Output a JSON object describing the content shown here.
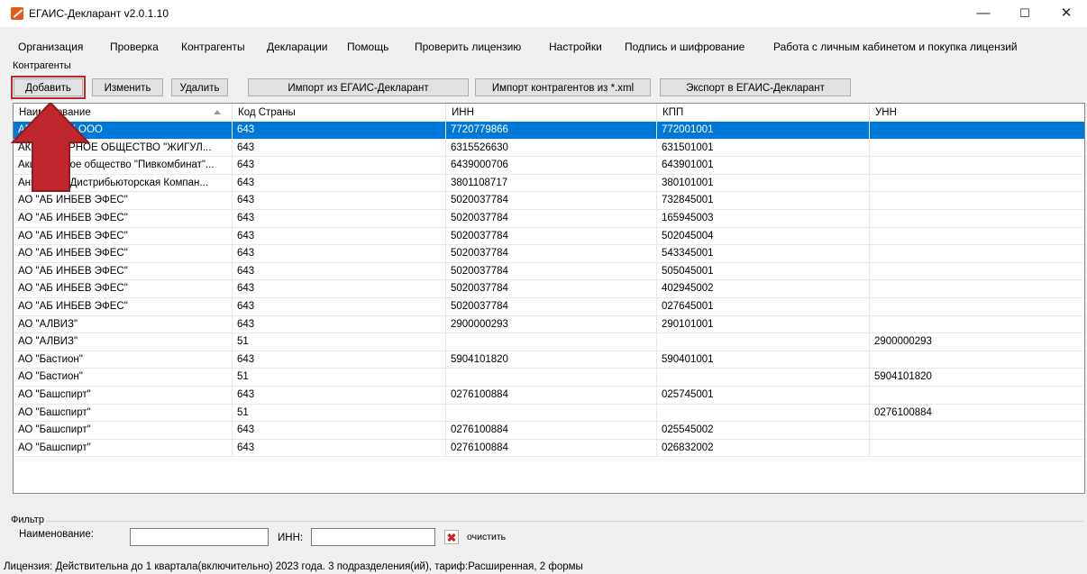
{
  "window": {
    "title": "ЕГАИС-Декларант v2.0.1.10",
    "minimize": "—",
    "maximize": "☐",
    "close": "✕"
  },
  "menu": [
    "Организация",
    "Проверка",
    "Контрагенты",
    "Декларации",
    "Помощь",
    "Проверить лицензию",
    "Настройки",
    "Подпись и шифрование",
    "Работа с личным кабинетом и покупка лицензий"
  ],
  "section_label": "Контрагенты",
  "toolbar": {
    "add": "Добавить",
    "edit": "Изменить",
    "delete": "Удалить",
    "import_egais": "Импорт из ЕГАИС-Декларант",
    "import_xml": "Импорт контрагентов из *.xml",
    "export_egais": "Экспорт в ЕГАИС-Декларант"
  },
  "table": {
    "columns": [
      "Наименование",
      "Код Страны",
      "ИНН",
      "КПП",
      "УНН"
    ],
    "rows": [
      [
        "АРКА-ПАРК ООО",
        "643",
        "7720779866",
        "772001001",
        ""
      ],
      [
        "АКЦИОНЕРНОЕ ОБЩЕСТВО \"ЖИГУЛ...",
        "643",
        "6315526630",
        "631501001",
        ""
      ],
      [
        "Акционерное общество \"Пивкомбинат\"...",
        "643",
        "6439000706",
        "643901001",
        ""
      ],
      [
        "Ангарская Дистрибьюторская Компан...",
        "643",
        "3801108717",
        "380101001",
        ""
      ],
      [
        "АО \"АБ ИНБЕВ ЭФЕС\"",
        "643",
        "5020037784",
        "732845001",
        ""
      ],
      [
        "АО \"АБ ИНБЕВ ЭФЕС\"",
        "643",
        "5020037784",
        "165945003",
        ""
      ],
      [
        "АО \"АБ ИНБЕВ ЭФЕС\"",
        "643",
        "5020037784",
        "502045004",
        ""
      ],
      [
        "АО \"АБ ИНБЕВ ЭФЕС\"",
        "643",
        "5020037784",
        "543345001",
        ""
      ],
      [
        "АО \"АБ ИНБЕВ ЭФЕС\"",
        "643",
        "5020037784",
        "505045001",
        ""
      ],
      [
        "АО \"АБ ИНБЕВ ЭФЕС\"",
        "643",
        "5020037784",
        "402945002",
        ""
      ],
      [
        "АО \"АБ ИНБЕВ ЭФЕС\"",
        "643",
        "5020037784",
        "027645001",
        ""
      ],
      [
        "АО \"АЛВИЗ\"",
        "643",
        "2900000293",
        "290101001",
        ""
      ],
      [
        "АО \"АЛВИЗ\"",
        "51",
        "",
        "",
        "2900000293"
      ],
      [
        "АО \"Бастион\"",
        "643",
        "5904101820",
        "590401001",
        ""
      ],
      [
        "АО \"Бастион\"",
        "51",
        "",
        "",
        "5904101820"
      ],
      [
        "АО \"Башспирт\"",
        "643",
        "0276100884",
        "025745001",
        ""
      ],
      [
        "АО \"Башспирт\"",
        "51",
        "",
        "",
        "0276100884"
      ],
      [
        "АО \"Башспирт\"",
        "643",
        "0276100884",
        "025545002",
        ""
      ],
      [
        "АО \"Башспирт\"",
        "643",
        "0276100884",
        "026832002",
        ""
      ]
    ],
    "selected_row": 0
  },
  "filter": {
    "legend": "Фильтр",
    "name_label": "Наименование:",
    "inn_label": "ИНН:",
    "name_value": "",
    "inn_value": "",
    "clear_label": "очистить"
  },
  "status": "Лицензия: Действительна до 1 квартала(включительно) 2023 года. 3 подразделения(ий), тариф:Расширенная, 2 формы",
  "colors": {
    "selection": "#0078d7",
    "arrow": "#c0272d",
    "highlight": "#c0272d"
  }
}
